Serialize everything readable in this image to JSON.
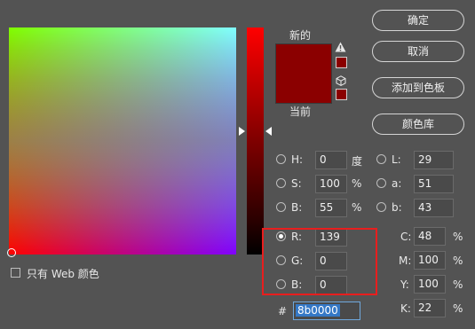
{
  "buttons": {
    "ok": "确定",
    "cancel": "取消",
    "add_to_swatches": "添加到色板",
    "color_libraries": "颜色库"
  },
  "preview": {
    "new_label": "新的",
    "current_label": "当前",
    "color": "#8b0000"
  },
  "web_only": {
    "label": "只有 Web 颜色",
    "checked": false
  },
  "hsb": {
    "h": {
      "label": "H:",
      "value": "0",
      "unit": "度"
    },
    "s": {
      "label": "S:",
      "value": "100",
      "unit": "%"
    },
    "b": {
      "label": "B:",
      "value": "55",
      "unit": "%"
    }
  },
  "rgb": {
    "r": {
      "label": "R:",
      "value": "139"
    },
    "g": {
      "label": "G:",
      "value": "0"
    },
    "b": {
      "label": "B:",
      "value": "0"
    }
  },
  "lab": {
    "l": {
      "label": "L:",
      "value": "29"
    },
    "a": {
      "label": "a:",
      "value": "51"
    },
    "b": {
      "label": "b:",
      "value": "43"
    }
  },
  "cmyk": {
    "c": {
      "label": "C:",
      "value": "48",
      "unit": "%"
    },
    "m": {
      "label": "M:",
      "value": "100",
      "unit": "%"
    },
    "y": {
      "label": "Y:",
      "value": "100",
      "unit": "%"
    },
    "k": {
      "label": "K:",
      "value": "22",
      "unit": "%"
    }
  },
  "hex": {
    "label": "#",
    "value": "8b0000"
  },
  "selected_mode": "R",
  "icons": [
    "warning-icon",
    "cube-icon"
  ]
}
